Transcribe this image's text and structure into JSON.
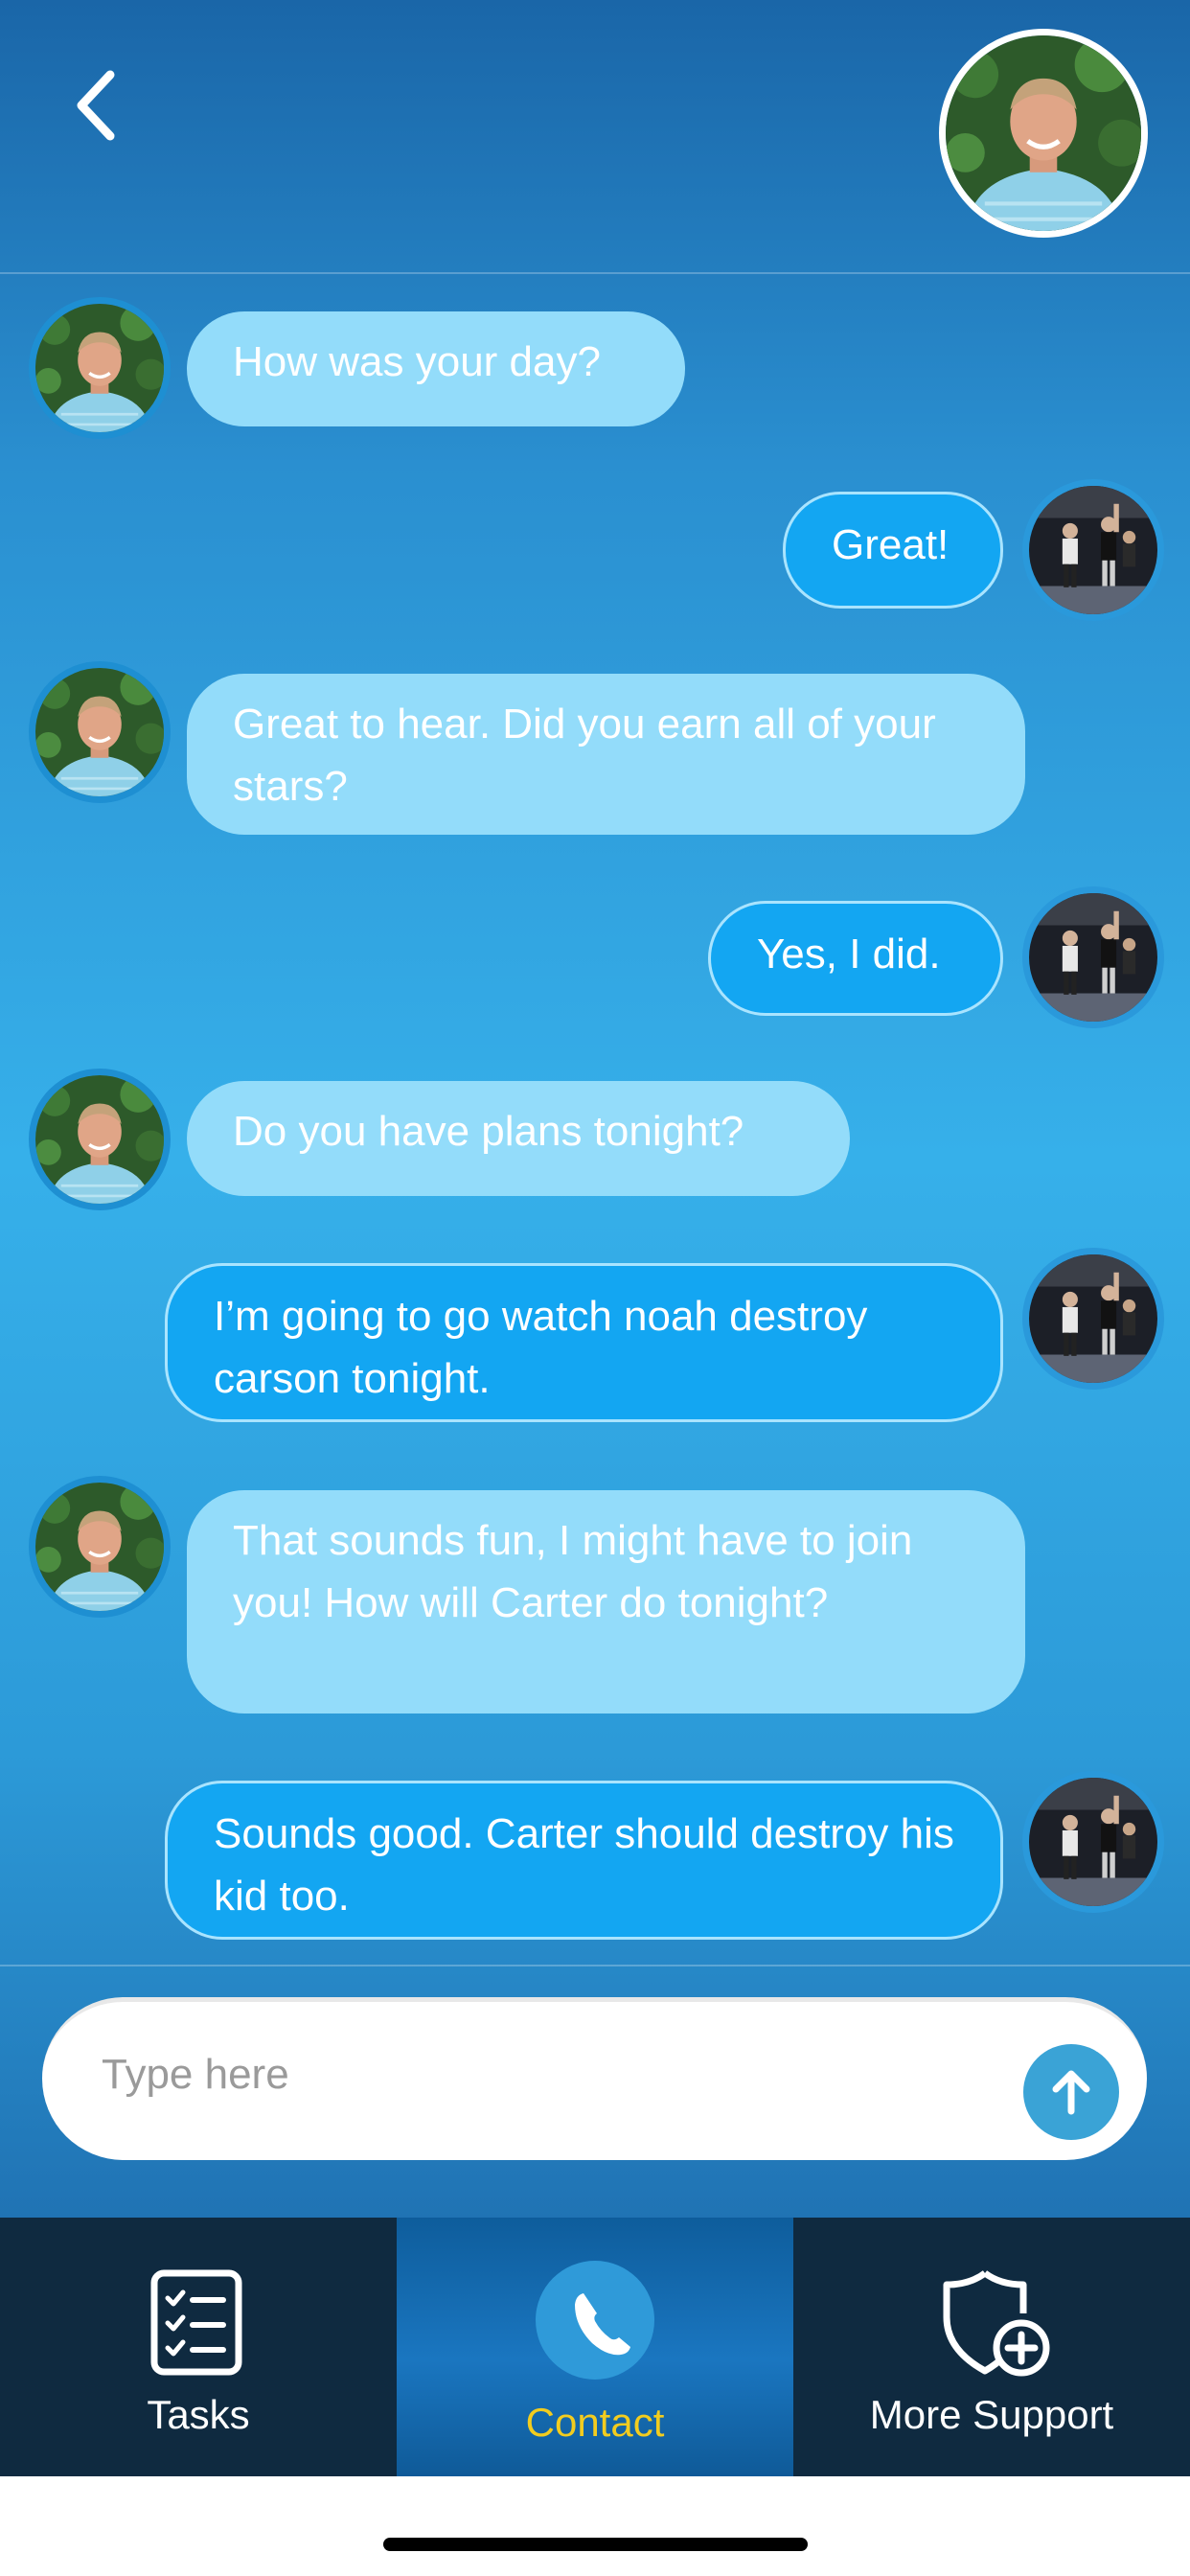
{
  "header": {
    "back_icon": "chevron-left-icon",
    "contact_avatar_alt": "contact-avatar"
  },
  "messages": [
    {
      "from": "contact",
      "text": "How was your day?"
    },
    {
      "from": "user",
      "text": "Great!"
    },
    {
      "from": "contact",
      "text": "Great to hear. Did you earn all of your stars?"
    },
    {
      "from": "user",
      "text": "Yes, I did."
    },
    {
      "from": "contact",
      "text": "Do you have plans tonight?"
    },
    {
      "from": "user",
      "text": "I’m going to go watch noah destroy carson tonight."
    },
    {
      "from": "contact",
      "text": "That sounds fun, I might have to join you! How will Carter do tonight?"
    },
    {
      "from": "user",
      "text": "Sounds good. Carter should destroy his kid too."
    }
  ],
  "composer": {
    "placeholder": "Type here",
    "send_icon": "arrow-up-icon"
  },
  "tabs": [
    {
      "label": "Tasks",
      "icon": "checklist-icon",
      "active": false
    },
    {
      "label": "Contact",
      "icon": "phone-icon",
      "active": true
    },
    {
      "label": "More Support",
      "icon": "shield-plus-icon",
      "active": false
    }
  ],
  "colors": {
    "incoming_bubble": "#93dcfa",
    "outgoing_bubble": "#13a6f2",
    "active_tab_label": "#f2cc1f",
    "tabbar_bg": "#0f2a40"
  }
}
